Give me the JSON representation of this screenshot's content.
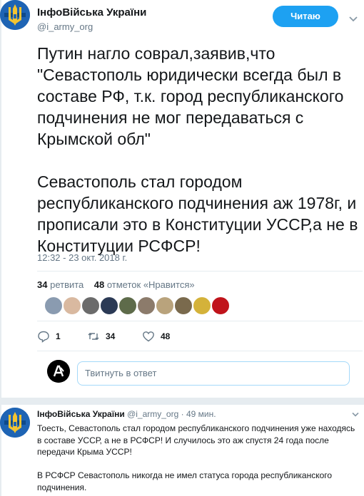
{
  "tweet": {
    "author": {
      "name": "ІнфоВійська України",
      "handle": "@i_army_org"
    },
    "follow_label": "Читаю",
    "text": "Путин нагло соврал,заявив,что \"Севастополь юридически всегда был в составе РФ, т.к. город республиканского подчинения не мог передаваться с Крымской обл\"\n\nСевастополь стал городом республиканского подчинения аж 1978г, и прописали это в Конституции УССР,а не в Конституции РСФСР!",
    "timestamp": "12:32 - 23 окт. 2018 г.",
    "retweets_count": "34",
    "retweets_label": "ретвита",
    "likes_count": "48",
    "likes_label": "отметок «Нравится»",
    "actions": {
      "reply_count": "1",
      "retweet_count": "34",
      "like_count": "48"
    }
  },
  "composer": {
    "placeholder": "Твитнуть в ответ"
  },
  "reply": {
    "author": {
      "name": "ІнфоВійська України",
      "handle": "@i_army_org"
    },
    "time": "· 49 мин.",
    "text": "Тоесть, Севастополь стал городом республиканского подчинения уже находясь в составе УССР, а не в РСФСР! И случилось это аж спустя 24 года после передачи Крыма УССР!\n\nВ РСФСР Севастополь никогда не имел статуса города республиканского подчинения."
  },
  "colors": {
    "accent": "#1da1f2",
    "text": "#14171a",
    "secondary": "#657786",
    "avatar_blue": "#1e64b4",
    "divider": "#e6ecf0"
  },
  "icons": [
    "trident-avatar",
    "caret-down-icon",
    "reply-icon",
    "retweet-icon",
    "like-icon",
    "user-avatar"
  ]
}
